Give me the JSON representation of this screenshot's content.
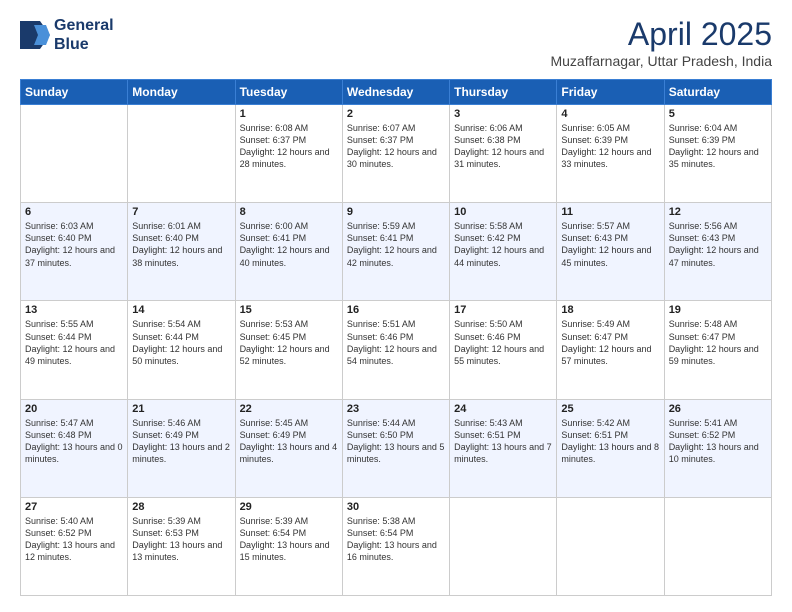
{
  "header": {
    "logo": {
      "line1": "General",
      "line2": "Blue"
    },
    "title": "April 2025",
    "subtitle": "Muzaffarnagar, Uttar Pradesh, India"
  },
  "weekdays": [
    "Sunday",
    "Monday",
    "Tuesday",
    "Wednesday",
    "Thursday",
    "Friday",
    "Saturday"
  ],
  "weeks": [
    [
      {
        "day": "",
        "sunrise": "",
        "sunset": "",
        "daylight": ""
      },
      {
        "day": "",
        "sunrise": "",
        "sunset": "",
        "daylight": ""
      },
      {
        "day": "1",
        "sunrise": "Sunrise: 6:08 AM",
        "sunset": "Sunset: 6:37 PM",
        "daylight": "Daylight: 12 hours and 28 minutes."
      },
      {
        "day": "2",
        "sunrise": "Sunrise: 6:07 AM",
        "sunset": "Sunset: 6:37 PM",
        "daylight": "Daylight: 12 hours and 30 minutes."
      },
      {
        "day": "3",
        "sunrise": "Sunrise: 6:06 AM",
        "sunset": "Sunset: 6:38 PM",
        "daylight": "Daylight: 12 hours and 31 minutes."
      },
      {
        "day": "4",
        "sunrise": "Sunrise: 6:05 AM",
        "sunset": "Sunset: 6:39 PM",
        "daylight": "Daylight: 12 hours and 33 minutes."
      },
      {
        "day": "5",
        "sunrise": "Sunrise: 6:04 AM",
        "sunset": "Sunset: 6:39 PM",
        "daylight": "Daylight: 12 hours and 35 minutes."
      }
    ],
    [
      {
        "day": "6",
        "sunrise": "Sunrise: 6:03 AM",
        "sunset": "Sunset: 6:40 PM",
        "daylight": "Daylight: 12 hours and 37 minutes."
      },
      {
        "day": "7",
        "sunrise": "Sunrise: 6:01 AM",
        "sunset": "Sunset: 6:40 PM",
        "daylight": "Daylight: 12 hours and 38 minutes."
      },
      {
        "day": "8",
        "sunrise": "Sunrise: 6:00 AM",
        "sunset": "Sunset: 6:41 PM",
        "daylight": "Daylight: 12 hours and 40 minutes."
      },
      {
        "day": "9",
        "sunrise": "Sunrise: 5:59 AM",
        "sunset": "Sunset: 6:41 PM",
        "daylight": "Daylight: 12 hours and 42 minutes."
      },
      {
        "day": "10",
        "sunrise": "Sunrise: 5:58 AM",
        "sunset": "Sunset: 6:42 PM",
        "daylight": "Daylight: 12 hours and 44 minutes."
      },
      {
        "day": "11",
        "sunrise": "Sunrise: 5:57 AM",
        "sunset": "Sunset: 6:43 PM",
        "daylight": "Daylight: 12 hours and 45 minutes."
      },
      {
        "day": "12",
        "sunrise": "Sunrise: 5:56 AM",
        "sunset": "Sunset: 6:43 PM",
        "daylight": "Daylight: 12 hours and 47 minutes."
      }
    ],
    [
      {
        "day": "13",
        "sunrise": "Sunrise: 5:55 AM",
        "sunset": "Sunset: 6:44 PM",
        "daylight": "Daylight: 12 hours and 49 minutes."
      },
      {
        "day": "14",
        "sunrise": "Sunrise: 5:54 AM",
        "sunset": "Sunset: 6:44 PM",
        "daylight": "Daylight: 12 hours and 50 minutes."
      },
      {
        "day": "15",
        "sunrise": "Sunrise: 5:53 AM",
        "sunset": "Sunset: 6:45 PM",
        "daylight": "Daylight: 12 hours and 52 minutes."
      },
      {
        "day": "16",
        "sunrise": "Sunrise: 5:51 AM",
        "sunset": "Sunset: 6:46 PM",
        "daylight": "Daylight: 12 hours and 54 minutes."
      },
      {
        "day": "17",
        "sunrise": "Sunrise: 5:50 AM",
        "sunset": "Sunset: 6:46 PM",
        "daylight": "Daylight: 12 hours and 55 minutes."
      },
      {
        "day": "18",
        "sunrise": "Sunrise: 5:49 AM",
        "sunset": "Sunset: 6:47 PM",
        "daylight": "Daylight: 12 hours and 57 minutes."
      },
      {
        "day": "19",
        "sunrise": "Sunrise: 5:48 AM",
        "sunset": "Sunset: 6:47 PM",
        "daylight": "Daylight: 12 hours and 59 minutes."
      }
    ],
    [
      {
        "day": "20",
        "sunrise": "Sunrise: 5:47 AM",
        "sunset": "Sunset: 6:48 PM",
        "daylight": "Daylight: 13 hours and 0 minutes."
      },
      {
        "day": "21",
        "sunrise": "Sunrise: 5:46 AM",
        "sunset": "Sunset: 6:49 PM",
        "daylight": "Daylight: 13 hours and 2 minutes."
      },
      {
        "day": "22",
        "sunrise": "Sunrise: 5:45 AM",
        "sunset": "Sunset: 6:49 PM",
        "daylight": "Daylight: 13 hours and 4 minutes."
      },
      {
        "day": "23",
        "sunrise": "Sunrise: 5:44 AM",
        "sunset": "Sunset: 6:50 PM",
        "daylight": "Daylight: 13 hours and 5 minutes."
      },
      {
        "day": "24",
        "sunrise": "Sunrise: 5:43 AM",
        "sunset": "Sunset: 6:51 PM",
        "daylight": "Daylight: 13 hours and 7 minutes."
      },
      {
        "day": "25",
        "sunrise": "Sunrise: 5:42 AM",
        "sunset": "Sunset: 6:51 PM",
        "daylight": "Daylight: 13 hours and 8 minutes."
      },
      {
        "day": "26",
        "sunrise": "Sunrise: 5:41 AM",
        "sunset": "Sunset: 6:52 PM",
        "daylight": "Daylight: 13 hours and 10 minutes."
      }
    ],
    [
      {
        "day": "27",
        "sunrise": "Sunrise: 5:40 AM",
        "sunset": "Sunset: 6:52 PM",
        "daylight": "Daylight: 13 hours and 12 minutes."
      },
      {
        "day": "28",
        "sunrise": "Sunrise: 5:39 AM",
        "sunset": "Sunset: 6:53 PM",
        "daylight": "Daylight: 13 hours and 13 minutes."
      },
      {
        "day": "29",
        "sunrise": "Sunrise: 5:39 AM",
        "sunset": "Sunset: 6:54 PM",
        "daylight": "Daylight: 13 hours and 15 minutes."
      },
      {
        "day": "30",
        "sunrise": "Sunrise: 5:38 AM",
        "sunset": "Sunset: 6:54 PM",
        "daylight": "Daylight: 13 hours and 16 minutes."
      },
      {
        "day": "",
        "sunrise": "",
        "sunset": "",
        "daylight": ""
      },
      {
        "day": "",
        "sunrise": "",
        "sunset": "",
        "daylight": ""
      },
      {
        "day": "",
        "sunrise": "",
        "sunset": "",
        "daylight": ""
      }
    ]
  ]
}
